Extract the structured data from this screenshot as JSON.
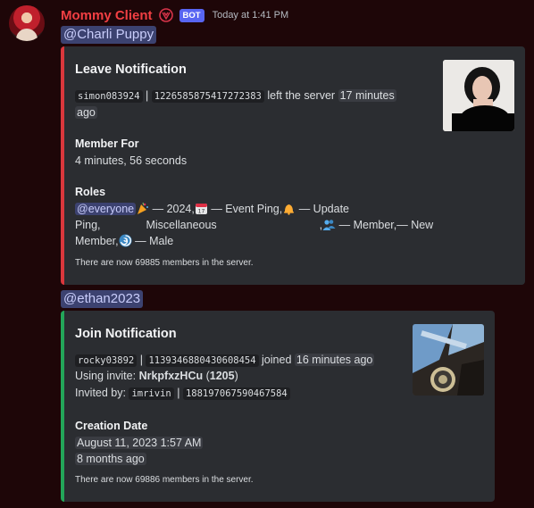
{
  "message": {
    "author": "Mommy Client",
    "bot_tag": "BOT",
    "timestamp": "Today at 1:41 PM"
  },
  "leave": {
    "mention": "@Charli Puppy",
    "title": "Leave Notification",
    "username_code": "simon083924",
    "sep": "|",
    "id_code": "1226585875417272383",
    "left_text": "left the server",
    "ago_line1": "17 minutes",
    "ago_line2": "ago",
    "member_for_label": "Member For",
    "member_for_value": "4 minutes, 56 seconds",
    "roles_label": "Roles",
    "roles": {
      "everyone": "@everyone",
      "r1": " — 2024,",
      "r2": " — Event Ping,",
      "r3": " — Update",
      "ping": "Ping,",
      "misc": "Miscellaneous",
      "comma": ",",
      "r4": " — Member,",
      "r5": "— New",
      "member": "Member,",
      "r6": " — Male"
    },
    "footer": "There are now 69885 members in the server."
  },
  "join": {
    "mention": "@ethan2023",
    "title": "Join Notification",
    "username_code": "rocky03892",
    "sep": "|",
    "id_code": "1139346880430608454",
    "joined_text": "joined",
    "ago": "16 minutes ago",
    "invite_label": "Using invite:",
    "invite_code": "NrkpfxzHCu",
    "invite_uses": "1205",
    "invited_by_label": "Invited by:",
    "inviter_code": "imrivin",
    "inviter_id_code": "188197067590467584",
    "creation_label": "Creation Date",
    "creation_date": "August 11, 2023 1:57 AM",
    "creation_ago": "8 months ago",
    "footer": "There are now 69886 members in the server."
  },
  "colors": {
    "leave_accent": "#da373c",
    "join_accent": "#23a559",
    "author": "#f23f43",
    "bot_tag": "#5865f2"
  },
  "icons": [
    "avatar",
    "app-emblem-icon",
    "party-popper-icon",
    "calendar-icon",
    "bell-icon",
    "busts-icon",
    "cyclone-icon"
  ]
}
